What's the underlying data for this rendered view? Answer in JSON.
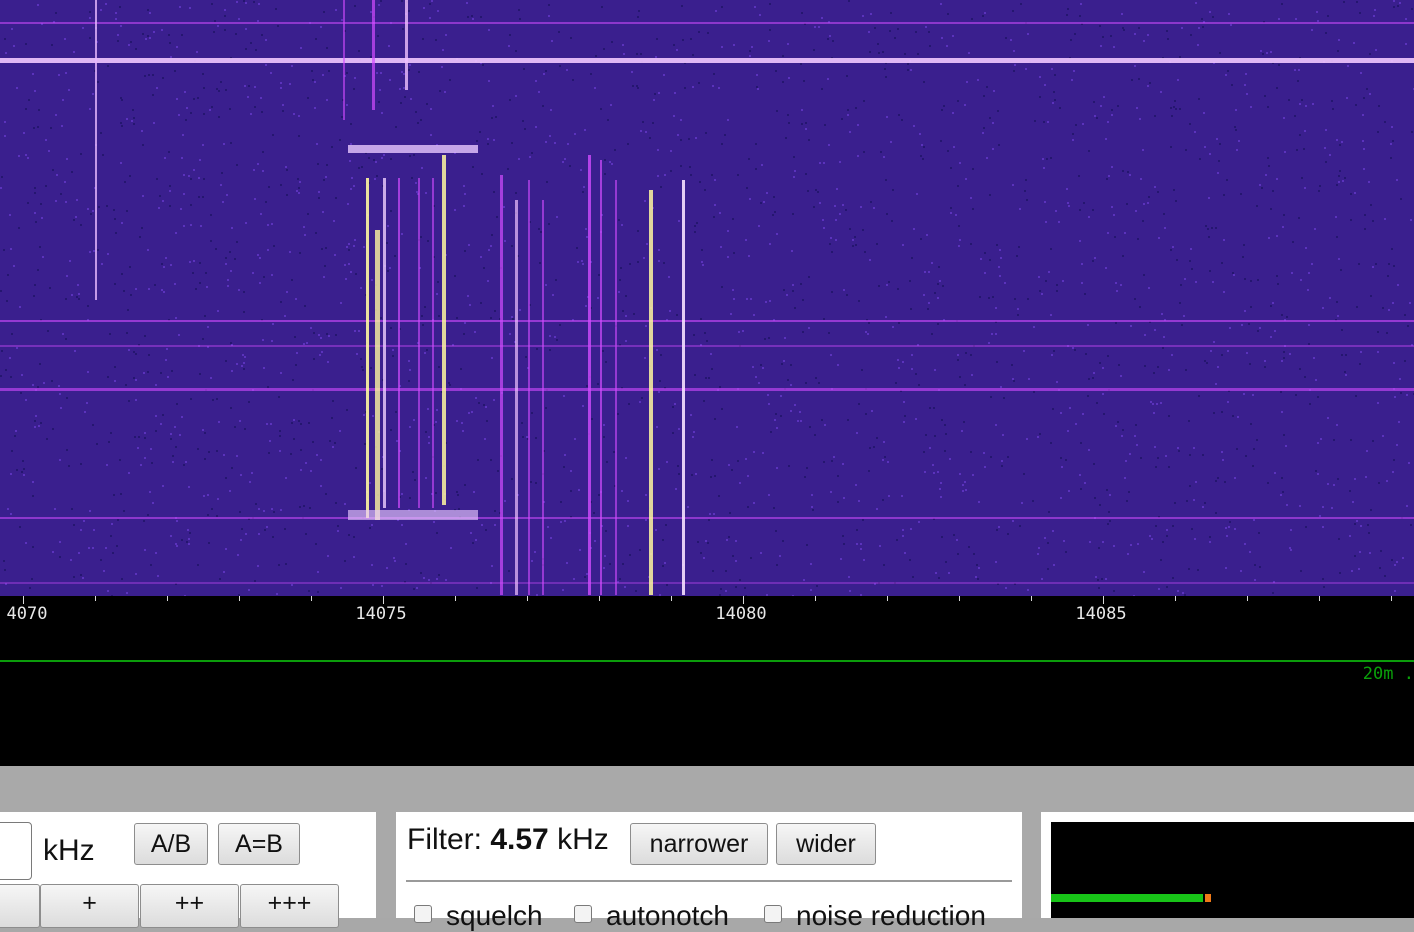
{
  "waterfall": {
    "colors": {
      "background": "#3a1f8e",
      "signal": "#d24bff",
      "strong": "#fff7a0"
    }
  },
  "scale": {
    "labels": [
      "4070",
      "14075",
      "14080",
      "14085"
    ],
    "unit_hint": "kHz"
  },
  "bandbar": {
    "band_label": "20m"
  },
  "frequency_panel": {
    "input_value": "",
    "unit_label": "kHz",
    "ab_button": "A/B",
    "aeqb_button": "A=B",
    "step_buttons": [
      "",
      "+",
      "++",
      "+++"
    ]
  },
  "filter_panel": {
    "label": "Filter:",
    "value": "4.57",
    "unit": "kHz",
    "narrower_button": "narrower",
    "wider_button": "wider",
    "checkboxes": [
      "squelch",
      "autonotch",
      "noise reduction"
    ]
  },
  "smeter": {
    "level_fraction": 0.42,
    "peak_fraction": 0.425,
    "colors": {
      "bar": "#18c418",
      "peak": "#f07a18"
    }
  }
}
